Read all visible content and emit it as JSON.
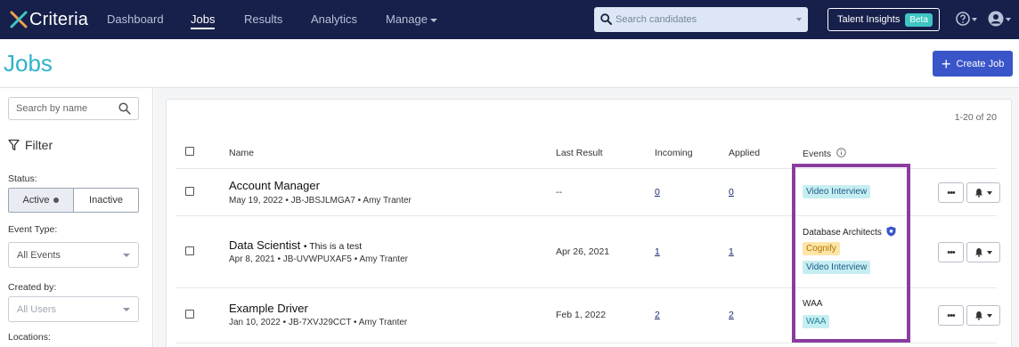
{
  "nav": {
    "brand": "Criteria",
    "items": [
      {
        "label": "Dashboard"
      },
      {
        "label": "Jobs"
      },
      {
        "label": "Results"
      },
      {
        "label": "Analytics"
      },
      {
        "label": "Manage"
      }
    ],
    "search_placeholder": "Search candidates",
    "talent_insights": "Talent Insights",
    "beta": "Beta"
  },
  "page": {
    "title": "Jobs",
    "create_button": "Create Job"
  },
  "sidebar": {
    "search_placeholder": "Search by name",
    "filter_title": "Filter",
    "status_label": "Status:",
    "status_active": "Active",
    "status_inactive": "Inactive",
    "event_type_label": "Event Type:",
    "event_type_value": "All Events",
    "created_by_label": "Created by:",
    "created_by_value": "All Users",
    "locations_label": "Locations:"
  },
  "table": {
    "count": "1-20 of 20",
    "headers": {
      "name": "Name",
      "last_result": "Last Result",
      "incoming": "Incoming",
      "applied": "Applied",
      "events": "Events"
    },
    "rows": [
      {
        "name": "Account Manager",
        "note": "",
        "meta": "May 19, 2022 • JB-JBSJLMGA7 • Amy Tranter",
        "last_result": "--",
        "incoming": "0",
        "applied": "0",
        "events": {
          "label": "",
          "tags": [
            "Video Interview"
          ]
        }
      },
      {
        "name": "Data Scientist",
        "note": "• This is a test",
        "meta": "Apr 8, 2021 • JB-UVWPUXAF5 • Amy Tranter",
        "last_result": "Apr 26, 2021",
        "incoming": "1",
        "applied": "1",
        "events": {
          "label": "Database Architects",
          "tags": [
            "Cognify",
            "Video Interview"
          ]
        }
      },
      {
        "name": "Example Driver",
        "note": "",
        "meta": "Jan 10, 2022 • JB-7XVJ29CCT • Amy Tranter",
        "last_result": "Feb 1, 2022",
        "incoming": "2",
        "applied": "2",
        "events": {
          "label": "WAA",
          "tags": [
            "WAA"
          ]
        }
      }
    ]
  },
  "colors": {
    "nav_bg": "#16204a",
    "title": "#2fb3c9",
    "primary_button": "#3a55c9",
    "highlight": "#8a3d9e"
  }
}
